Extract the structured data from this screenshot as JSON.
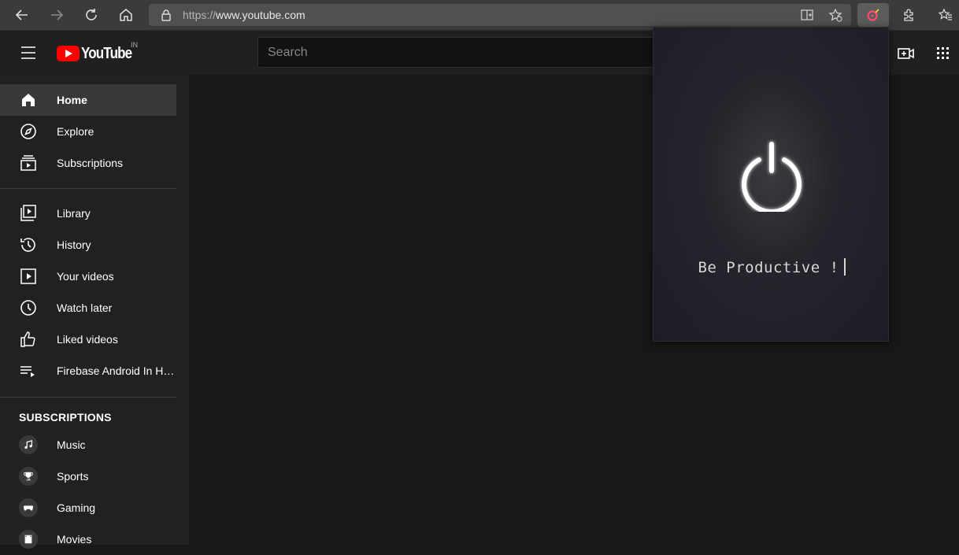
{
  "browser": {
    "url_protocol": "https://",
    "url_host": "www.youtube.com",
    "icons": [
      "back-icon",
      "forward-icon",
      "refresh-icon",
      "home-icon",
      "lock-icon",
      "split-screen-icon",
      "add-favorite-icon",
      "extension-icon",
      "extensions-puzzle-icon",
      "favorites-icon"
    ]
  },
  "header": {
    "logo_text": "YouTube",
    "region": "IN",
    "search_placeholder": "Search"
  },
  "sidebar": {
    "primary": [
      {
        "label": "Home",
        "icon": "home-icon",
        "active": true
      },
      {
        "label": "Explore",
        "icon": "compass-icon"
      },
      {
        "label": "Subscriptions",
        "icon": "subscriptions-icon"
      }
    ],
    "library": [
      {
        "label": "Library",
        "icon": "library-icon"
      },
      {
        "label": "History",
        "icon": "history-icon"
      },
      {
        "label": "Your videos",
        "icon": "your-videos-icon"
      },
      {
        "label": "Watch later",
        "icon": "clock-icon"
      },
      {
        "label": "Liked videos",
        "icon": "thumbs-up-icon"
      },
      {
        "label": "Firebase Android In Hindi",
        "icon": "playlist-icon"
      }
    ],
    "subscriptions_title": "SUBSCRIPTIONS",
    "subscriptions": [
      {
        "label": "Music",
        "icon": "music-icon"
      },
      {
        "label": "Sports",
        "icon": "trophy-icon"
      },
      {
        "label": "Gaming",
        "icon": "gamepad-icon"
      },
      {
        "label": "Movies",
        "icon": "film-icon"
      }
    ]
  },
  "popup": {
    "message": "Be Productive !",
    "icon": "power-icon",
    "text_color": "#d7d7d7"
  },
  "colors": {
    "brand": "#ff0000",
    "sidebar_bg": "#212121",
    "main_bg": "#181818"
  }
}
